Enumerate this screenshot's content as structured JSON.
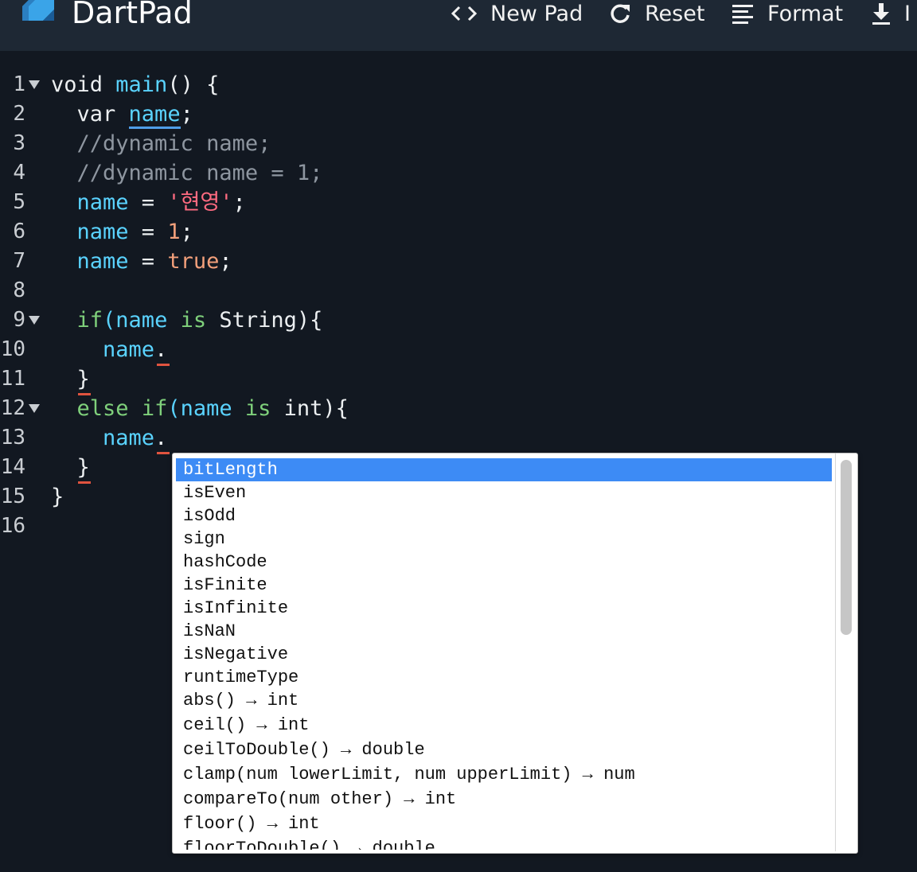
{
  "header": {
    "title": "DartPad",
    "actions": [
      {
        "label": "New Pad",
        "icon": "code-brackets-icon"
      },
      {
        "label": "Reset",
        "icon": "refresh-icon"
      },
      {
        "label": "Format",
        "icon": "format-lines-icon"
      },
      {
        "label": "I",
        "icon": "download-icon"
      }
    ]
  },
  "editor": {
    "line_numbers": [
      "1",
      "2",
      "3",
      "4",
      "5",
      "6",
      "7",
      "8",
      "9",
      "10",
      "11",
      "12",
      "13",
      "14",
      "15",
      "16"
    ],
    "tokens": {
      "l1": [
        "void ",
        "main",
        "() {"
      ],
      "l2": [
        "  var ",
        "name",
        ";"
      ],
      "l3": "  //dynamic name;",
      "l4": "  //dynamic name = 1;",
      "l5": [
        "  ",
        "name",
        " = ",
        "'현영'",
        ";"
      ],
      "l6": [
        "  ",
        "name",
        " = ",
        "1",
        ";"
      ],
      "l7": [
        "  ",
        "name",
        " = ",
        "true",
        ";"
      ],
      "l9": [
        "  ",
        "if",
        "(",
        "name",
        " ",
        "is",
        " String){"
      ],
      "l10": [
        "    ",
        "name",
        "."
      ],
      "l11": "  }",
      "l12": [
        "  ",
        "else",
        " ",
        "if",
        "(",
        "name",
        " ",
        "is",
        " int){"
      ],
      "l13": [
        "    ",
        "name",
        "."
      ],
      "l14": "  }",
      "l15": "}"
    }
  },
  "autocomplete": {
    "selected": "bitLength",
    "items": [
      "bitLength",
      "isEven",
      "isOdd",
      "sign",
      "hashCode",
      "isFinite",
      "isInfinite",
      "isNaN",
      "isNegative",
      "runtimeType",
      "abs() → int",
      "ceil() → int",
      "ceilToDouble() → double",
      "clamp(num lowerLimit, num upperLimit) → num",
      "compareTo(num other) → int",
      "floor() → int",
      "floorToDouble() → double"
    ]
  },
  "colors": {
    "background": "#121821",
    "header": "#1e2834",
    "identifier": "#5ad3ff",
    "keyword": "#7fd07b",
    "string": "#ff6b81",
    "literal": "#f3a07b",
    "comment": "#8e96a0",
    "selection": "#3d8bf5",
    "error_underline": "#e0533f"
  }
}
